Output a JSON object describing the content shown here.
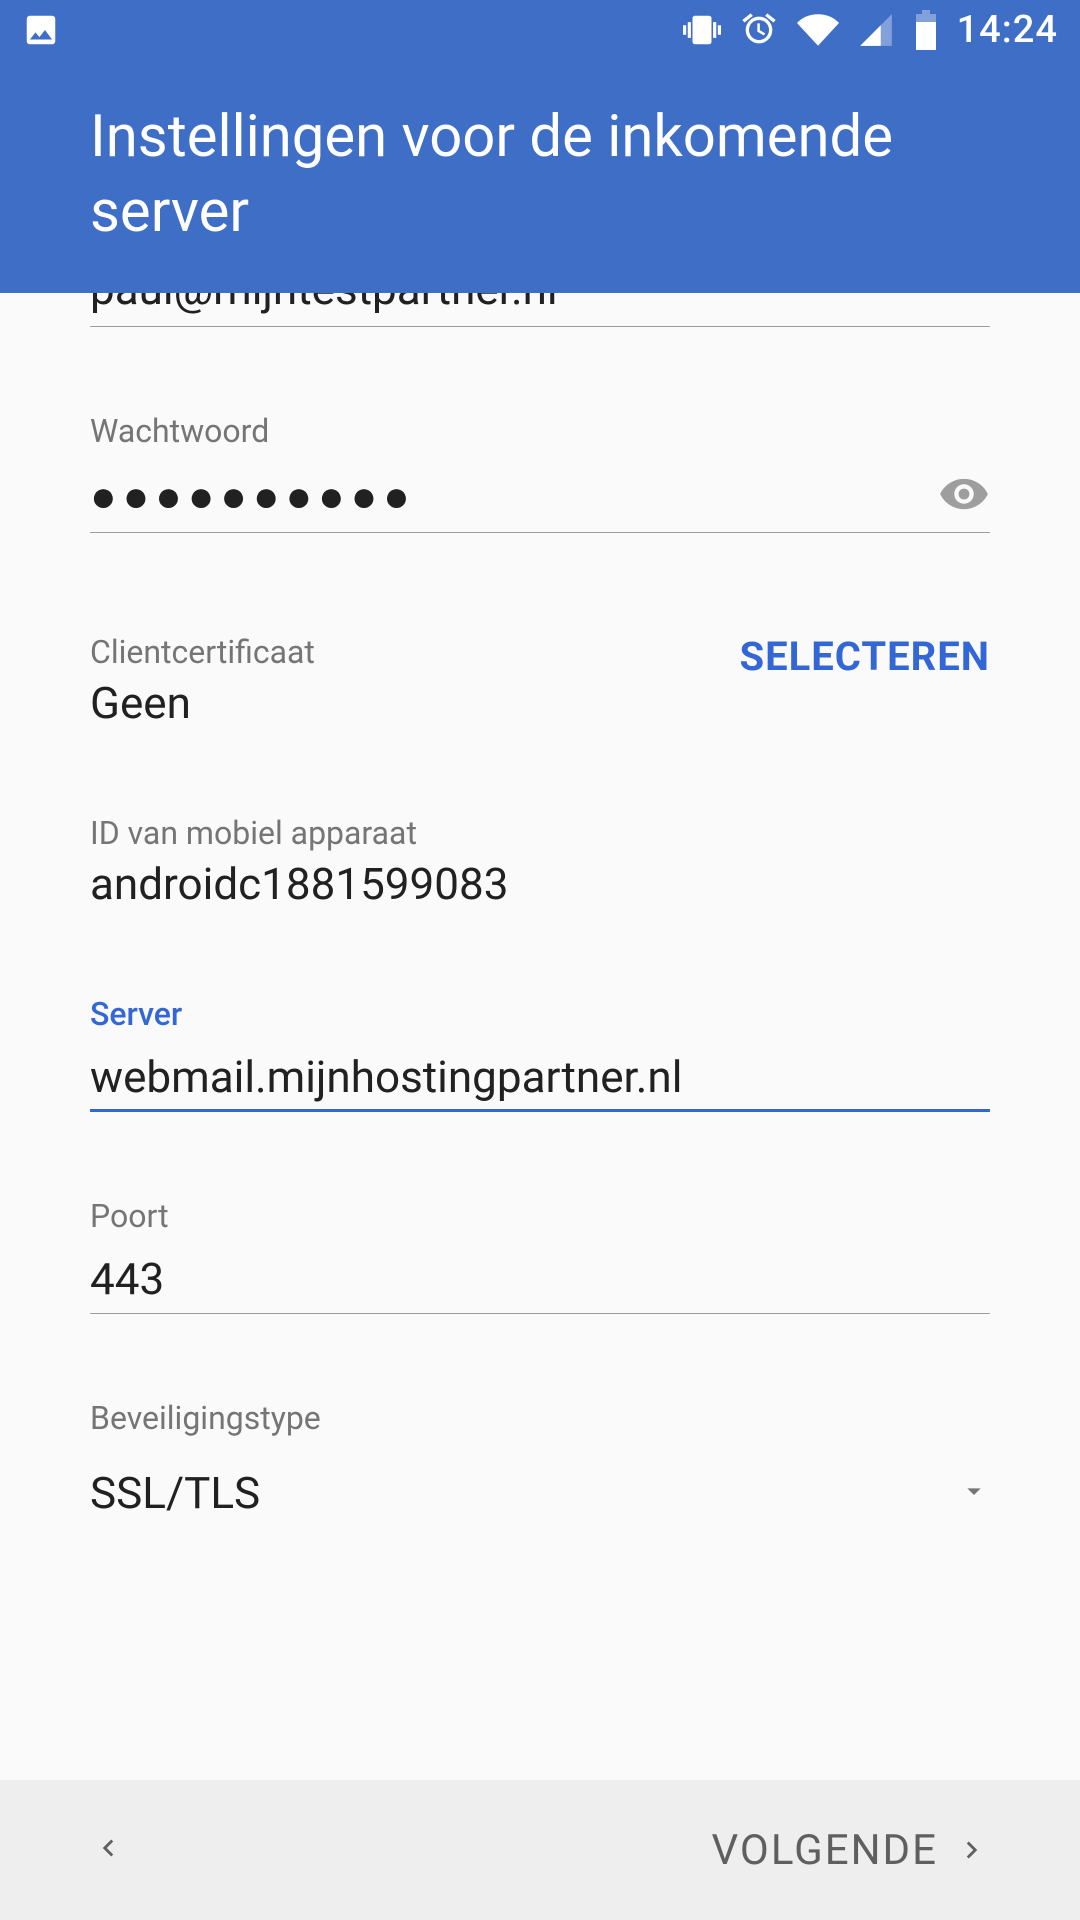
{
  "status": {
    "time": "14:24"
  },
  "header": {
    "title": "Instellingen voor de inkomende server"
  },
  "fields": {
    "email": {
      "value": "paul@mijntestpartner.nl"
    },
    "password": {
      "label": "Wachtwoord",
      "mask": "●●●●●●●●●●"
    },
    "client_cert": {
      "label": "Clientcertificaat",
      "value": "Geen",
      "select_label": "SELECTEREN"
    },
    "device_id": {
      "label": "ID van mobiel apparaat",
      "value": "androidc1881599083"
    },
    "server": {
      "label": "Server",
      "value": "webmail.mijnhostingpartner.nl"
    },
    "port": {
      "label": "Poort",
      "value": "443"
    },
    "security": {
      "label": "Beveiligingstype",
      "value": "SSL/TLS"
    }
  },
  "footer": {
    "next_label": "VOLGENDE"
  }
}
